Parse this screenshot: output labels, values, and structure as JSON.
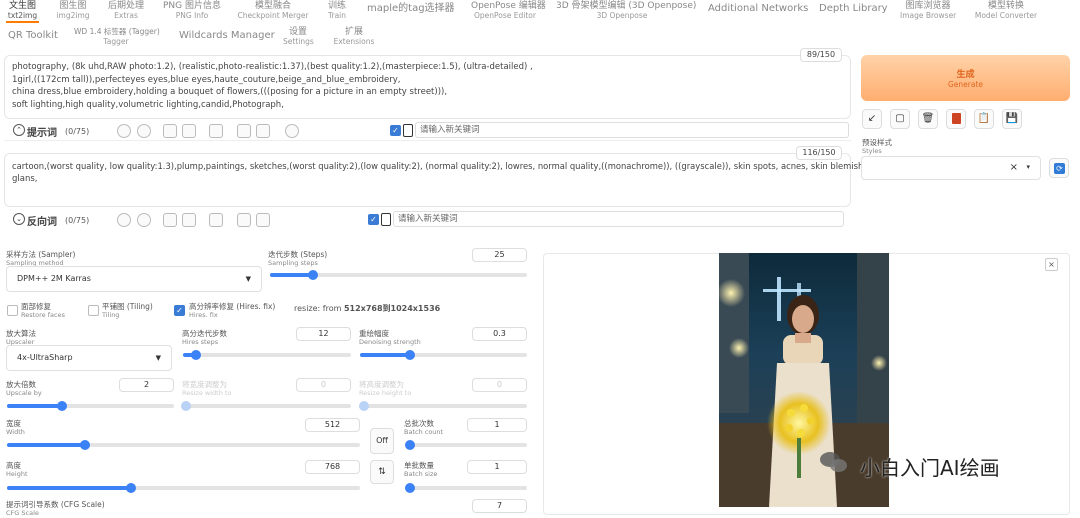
{
  "tabs": [
    {
      "zh": "文生图",
      "en": "txt2img"
    },
    {
      "zh": "图生图",
      "en": "img2img"
    },
    {
      "zh": "后期处理",
      "en": "Extras"
    },
    {
      "zh": "PNG 图片信息",
      "en": "PNG Info"
    },
    {
      "zh": "模型融合",
      "en": "Checkpoint Merger"
    },
    {
      "zh": "训练",
      "en": "Train"
    },
    {
      "zh": "maple的tag选择器"
    },
    {
      "zh": "OpenPose 编辑器",
      "en": "OpenPose Editor"
    },
    {
      "zh": "3D 骨架模型编辑 (3D Openpose)",
      "en": "3D Openpose"
    },
    {
      "zh": "Additional Networks"
    },
    {
      "zh": "Depth Library"
    },
    {
      "zh": "图库浏览器",
      "en": "Image Browser"
    },
    {
      "zh": "模型转换",
      "en": "Model Converter"
    },
    {
      "zh": "QR Toolkit"
    },
    {
      "zh": "WD 1.4 标签器 (Tagger)",
      "en": "Tagger"
    },
    {
      "zh": "Wildcards Manager"
    },
    {
      "zh": "设置",
      "en": "Settings"
    },
    {
      "zh": "扩展",
      "en": "Extensions"
    }
  ],
  "positive": {
    "lines": [
      "photography,  (8k uhd,RAW photo:1.2), (realistic,photo-realistic:1.37),(best quality:1.2),(masterpiece:1.5), (ultra-detailed) ,",
      "1girl,((172cm tall)),perfecteyes eyes,blue eyes,haute_couture,beige_and_blue_embroidery,",
      "china dress,blue embroidery,holding a bouquet of flowers,(((posing for a picture in an empty street))),",
      "soft lighting,high quality,volumetric lighting,candid,Photograph,"
    ],
    "counter": "89/150",
    "title": "提示词",
    "count": "(0/75)",
    "keyword_placeholder": "请输入新关键词"
  },
  "negative": {
    "lines": [
      "cartoon,(worst quality, low quality:1.3),plump,paintings, sketches,(worst quality:2),(low quality:2), (normal quality:2), lowres, normal quality,((monachrome)), ((grayscale)), skin spots, acnes, skin blemishes, age spot,",
      "glans,"
    ],
    "counter": "116/150",
    "title": "反向词",
    "count": "(0/75)",
    "keyword_placeholder": "请输入新关键词"
  },
  "generate": {
    "zh": "生成",
    "en": "Generate"
  },
  "styles": {
    "zh": "预设样式",
    "en": "Styles",
    "clear": "×",
    "arrow": "▾"
  },
  "sampler": {
    "zh": "采样方法 (Sampler)",
    "en": "Sampling method",
    "value": "DPM++ 2M Karras"
  },
  "steps": {
    "zh": "迭代步数 (Steps)",
    "en": "Sampling steps",
    "value": "25",
    "fraction": 0.167
  },
  "restore_faces": {
    "zh": "面部修复",
    "en": "Restore faces",
    "checked": false
  },
  "tiling": {
    "zh": "平铺图 (Tiling)",
    "en": "Tiling",
    "checked": false
  },
  "hires_fix": {
    "zh": "高分辨率修复 (Hires. fix)",
    "en": "Hires. fix",
    "checked": true
  },
  "resize_info": {
    "prefix": "resize: from ",
    "value": "512x768到1024x1536"
  },
  "upscaler": {
    "zh": "放大算法",
    "en": "Upscaler",
    "value": "4x-UltraSharp"
  },
  "hires_steps": {
    "zh": "高分迭代步数",
    "en": "Hires steps",
    "value": "12",
    "fraction": 0.08
  },
  "denoising": {
    "zh": "重绘幅度",
    "en": "Denoising strength",
    "value": "0.3",
    "fraction": 0.3
  },
  "upscale_by": {
    "zh": "放大倍数",
    "en": "Upscale by",
    "value": "2",
    "fraction": 0.33
  },
  "resize_width": {
    "zh": "将宽度调整为",
    "en": "Resize width to",
    "value": "0",
    "fraction": 0
  },
  "resize_height": {
    "zh": "将高度调整为",
    "en": "Resize height to",
    "value": "0",
    "fraction": 0
  },
  "width": {
    "zh": "宽度",
    "en": "Width",
    "value": "512",
    "fraction": 0.22
  },
  "height": {
    "zh": "高度",
    "en": "Height",
    "value": "768",
    "fraction": 0.35
  },
  "batch_count": {
    "zh": "总批次数",
    "en": "Batch count",
    "value": "1",
    "fraction": 0.0
  },
  "batch_size": {
    "zh": "单批数量",
    "en": "Batch size",
    "value": "1",
    "fraction": 0.0
  },
  "cfg": {
    "zh": "提示词引导系数 (CFG Scale)",
    "en": "CFG Scale",
    "value": "7"
  },
  "off_label": "Off",
  "watermark": "小白入门AI绘画",
  "colors": {
    "accent": "#ff7c00",
    "slider": "#3b82f6",
    "generate_text": "#e0651d"
  }
}
